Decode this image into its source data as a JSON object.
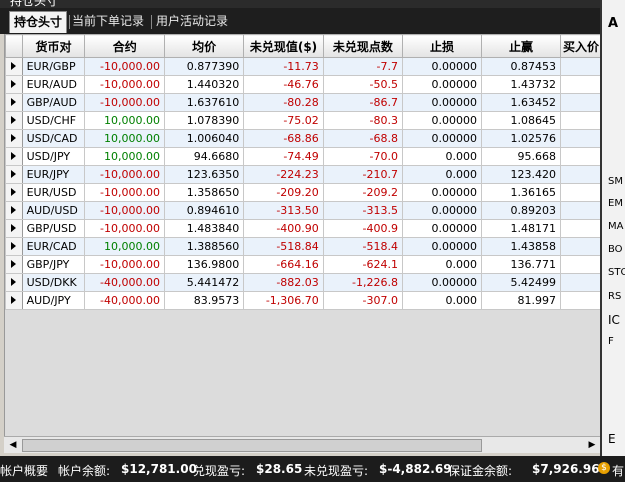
{
  "window": {
    "title": "持仓头寸"
  },
  "tabs": [
    {
      "label": "持仓头寸",
      "active": true
    },
    {
      "label": "当前下单记录",
      "active": false
    },
    {
      "label": "用户活动记录",
      "active": false
    }
  ],
  "table": {
    "headers": [
      "货币对",
      "合约",
      "均价",
      "未兑现值($)",
      "未兑现点数",
      "止损",
      "止赢",
      "买入价"
    ],
    "rows": [
      {
        "pair": "EUR/GBP",
        "contract": "-10,000.00",
        "avg": "0.877390",
        "upl": "-11.73",
        "pips": "-7.7",
        "stop": "0.00000",
        "limit": "0.87453"
      },
      {
        "pair": "EUR/AUD",
        "contract": "-10,000.00",
        "avg": "1.440320",
        "upl": "-46.76",
        "pips": "-50.5",
        "stop": "0.00000",
        "limit": "1.43732"
      },
      {
        "pair": "GBP/AUD",
        "contract": "-10,000.00",
        "avg": "1.637610",
        "upl": "-80.28",
        "pips": "-86.7",
        "stop": "0.00000",
        "limit": "1.63452"
      },
      {
        "pair": "USD/CHF",
        "contract": "10,000.00",
        "avg": "1.078390",
        "upl": "-75.02",
        "pips": "-80.3",
        "stop": "0.00000",
        "limit": "1.08645"
      },
      {
        "pair": "USD/CAD",
        "contract": "10,000.00",
        "avg": "1.006040",
        "upl": "-68.86",
        "pips": "-68.8",
        "stop": "0.00000",
        "limit": "1.02576"
      },
      {
        "pair": "USD/JPY",
        "contract": "10,000.00",
        "avg": "94.6680",
        "upl": "-74.49",
        "pips": "-70.0",
        "stop": "0.000",
        "limit": "95.668"
      },
      {
        "pair": "EUR/JPY",
        "contract": "-10,000.00",
        "avg": "123.6350",
        "upl": "-224.23",
        "pips": "-210.7",
        "stop": "0.000",
        "limit": "123.420"
      },
      {
        "pair": "EUR/USD",
        "contract": "-10,000.00",
        "avg": "1.358650",
        "upl": "-209.20",
        "pips": "-209.2",
        "stop": "0.00000",
        "limit": "1.36165"
      },
      {
        "pair": "AUD/USD",
        "contract": "-10,000.00",
        "avg": "0.894610",
        "upl": "-313.50",
        "pips": "-313.5",
        "stop": "0.00000",
        "limit": "0.89203"
      },
      {
        "pair": "GBP/USD",
        "contract": "-10,000.00",
        "avg": "1.483840",
        "upl": "-400.90",
        "pips": "-400.9",
        "stop": "0.00000",
        "limit": "1.48171"
      },
      {
        "pair": "EUR/CAD",
        "contract": "10,000.00",
        "avg": "1.388560",
        "upl": "-518.84",
        "pips": "-518.4",
        "stop": "0.00000",
        "limit": "1.43858"
      },
      {
        "pair": "GBP/JPY",
        "contract": "-10,000.00",
        "avg": "136.9800",
        "upl": "-664.16",
        "pips": "-624.1",
        "stop": "0.000",
        "limit": "136.771"
      },
      {
        "pair": "USD/DKK",
        "contract": "-40,000.00",
        "avg": "5.441472",
        "upl": "-882.03",
        "pips": "-1,226.8",
        "stop": "0.00000",
        "limit": "5.42499"
      },
      {
        "pair": "AUD/JPY",
        "contract": "-40,000.00",
        "avg": "83.9573",
        "upl": "-1,306.70",
        "pips": "-307.0",
        "stop": "0.000",
        "limit": "81.997"
      }
    ]
  },
  "right_panel": {
    "items": [
      "A",
      "SM",
      "EM",
      "MA",
      "BO",
      "STO",
      "RS",
      "IC",
      "F",
      "E"
    ]
  },
  "status": {
    "account_overview": "帐户概要",
    "balance_label": "帐户余额:",
    "balance_value": "$12,781.00",
    "realized_label": "兑现盈亏:",
    "realized_value": "$28.65",
    "unrealized_label": "未兑现盈亏:",
    "unrealized_value": "$-4,882.69",
    "margin_label": "保证金余额:",
    "margin_value": "$7,926.96",
    "trailing": "有"
  },
  "colors": {
    "negative": "#c00000",
    "positive": "#008000",
    "odd_row": "#eaf2fb",
    "header_bg": "#1e1e1e"
  }
}
